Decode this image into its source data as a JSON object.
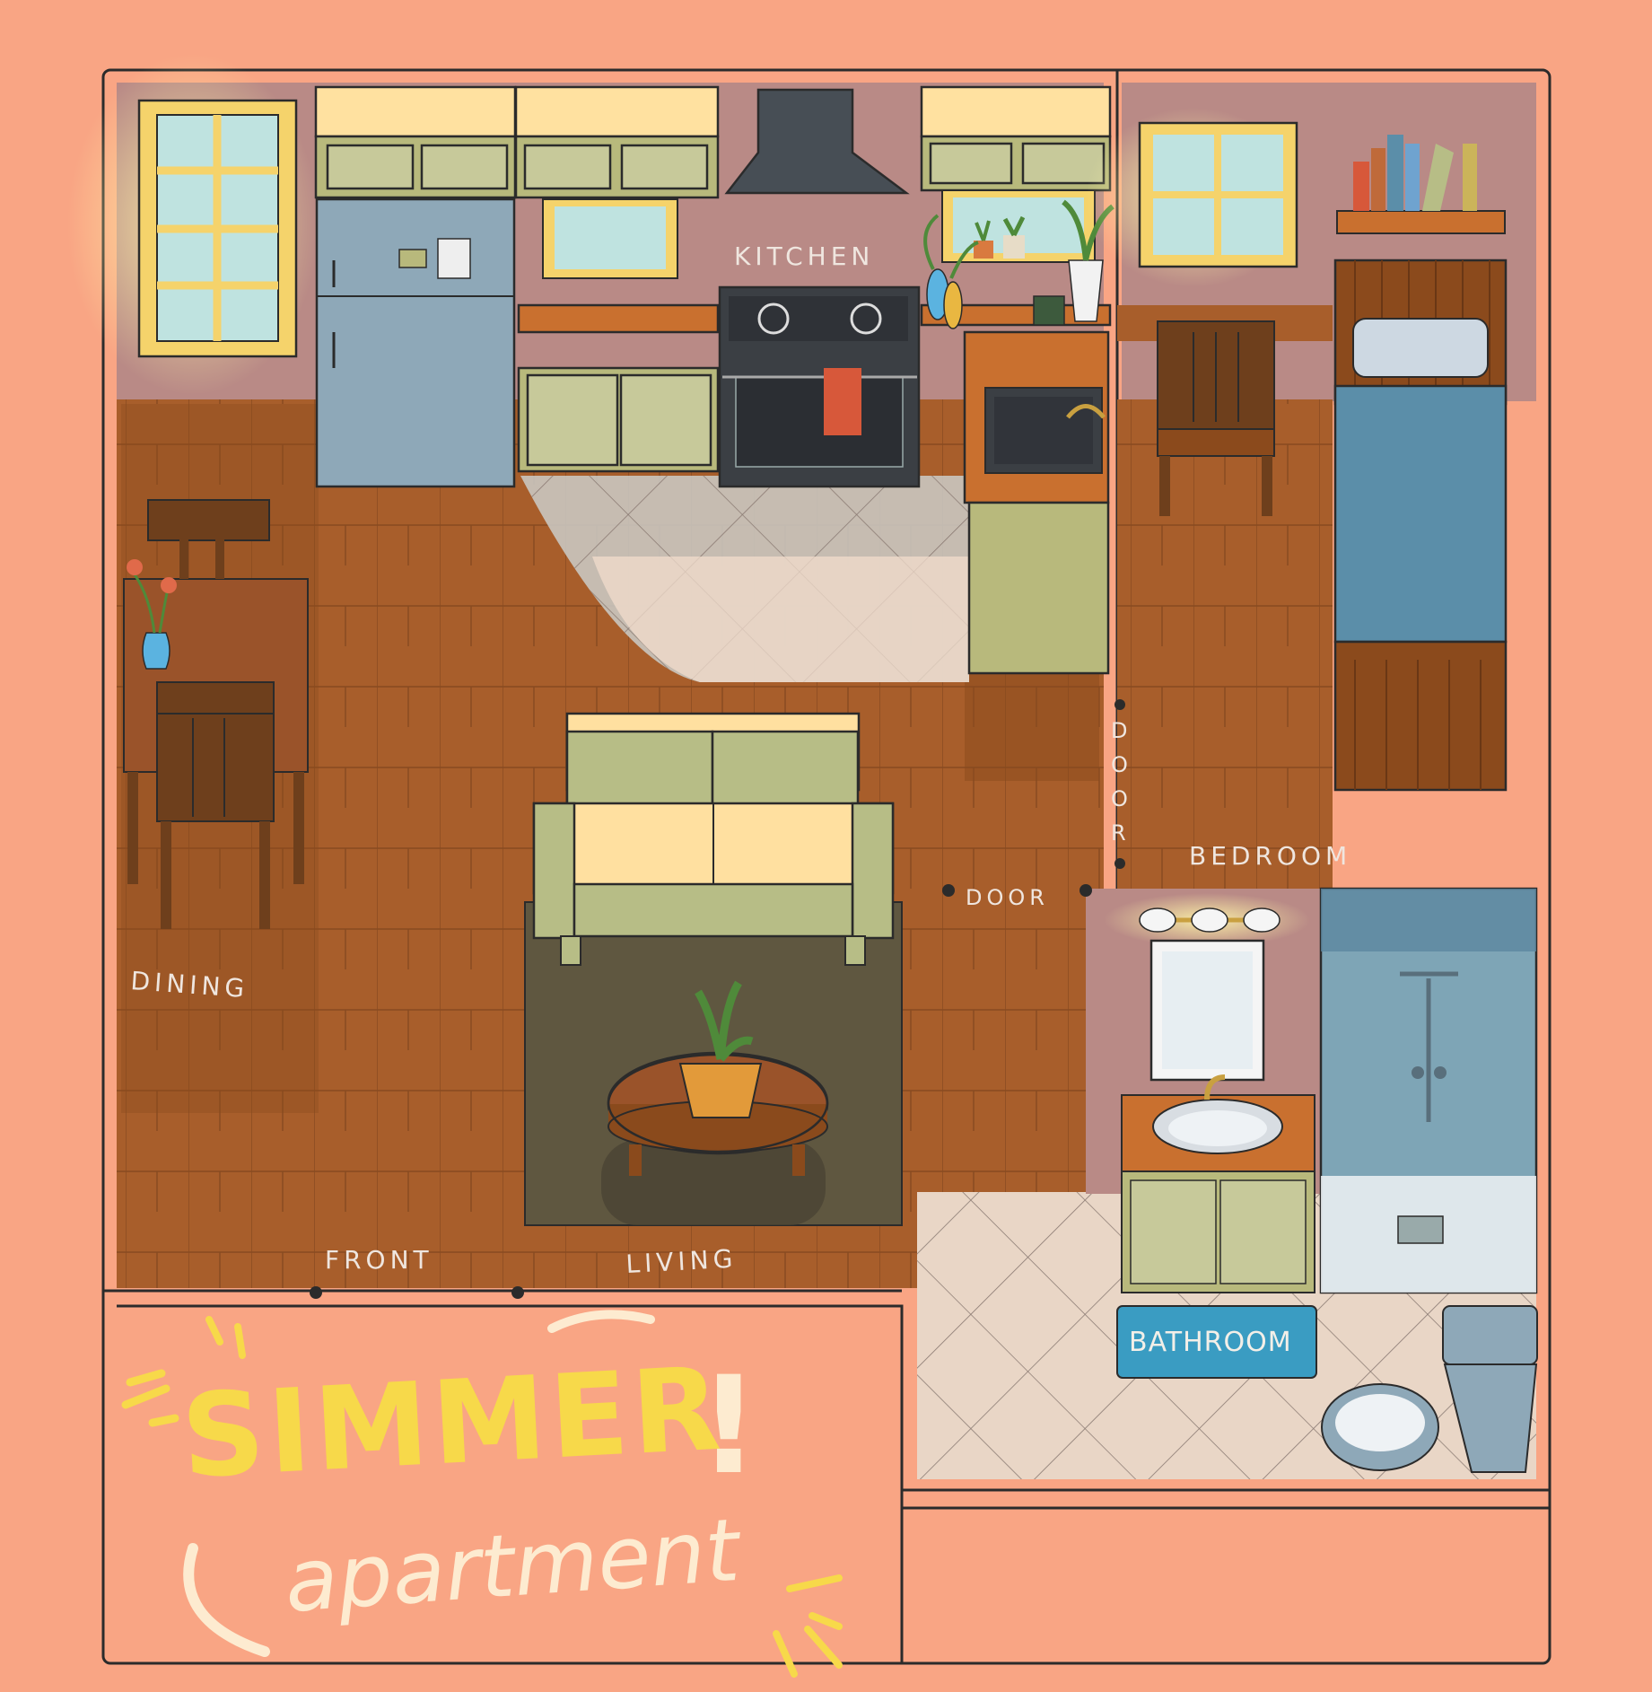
{
  "labels": {
    "kitchen": "KITCHEN",
    "dining": "DINING",
    "living": "LIVING",
    "front": "FRONT",
    "bedroom": "BEDROOM",
    "bathroom": "BATHROOM",
    "door_horizontal": "DOOR",
    "door_vertical": [
      "D",
      "O",
      "O",
      "R"
    ]
  },
  "title": {
    "main": "SIMMER",
    "bang": "!",
    "sub": "apartment"
  },
  "colors": {
    "background": "#f9a584",
    "wall": "#b98a86",
    "floor": "#a85e2b",
    "floor_shadow": "#8a4a1c",
    "cabinet": "#b8b97c",
    "cabinet_top": "#ffe1a0",
    "window_frame": "#f5d36b",
    "window_glass": "#bfe3e0",
    "fridge": "#8ea8b8",
    "stove": "#3b3f44",
    "hood": "#474e55",
    "tile": "#e9d6c6",
    "sofa": "#b7bd86",
    "sofa_cushion": "#ffe0a0",
    "rug": "#5f5740",
    "table": "#9a532a",
    "chair": "#6e3f1c",
    "bed_blanket": "#5b8ea9",
    "shower": "#7ea5b6",
    "bath_mat": "#3a9cc2",
    "title_yellow": "#f7d94a",
    "title_cream": "#fdebd0"
  },
  "icons": [
    "window-icon",
    "fridge-icon",
    "range-hood-icon",
    "stove-icon",
    "sink-icon",
    "plant-icon",
    "vase-icon",
    "bookshelf-icon",
    "bed-icon",
    "chair-icon",
    "sofa-icon",
    "coffee-table-icon",
    "bathroom-vanity-icon",
    "mirror-icon",
    "light-fixture-icon",
    "shower-icon",
    "toilet-icon",
    "door-hinge-icon"
  ]
}
